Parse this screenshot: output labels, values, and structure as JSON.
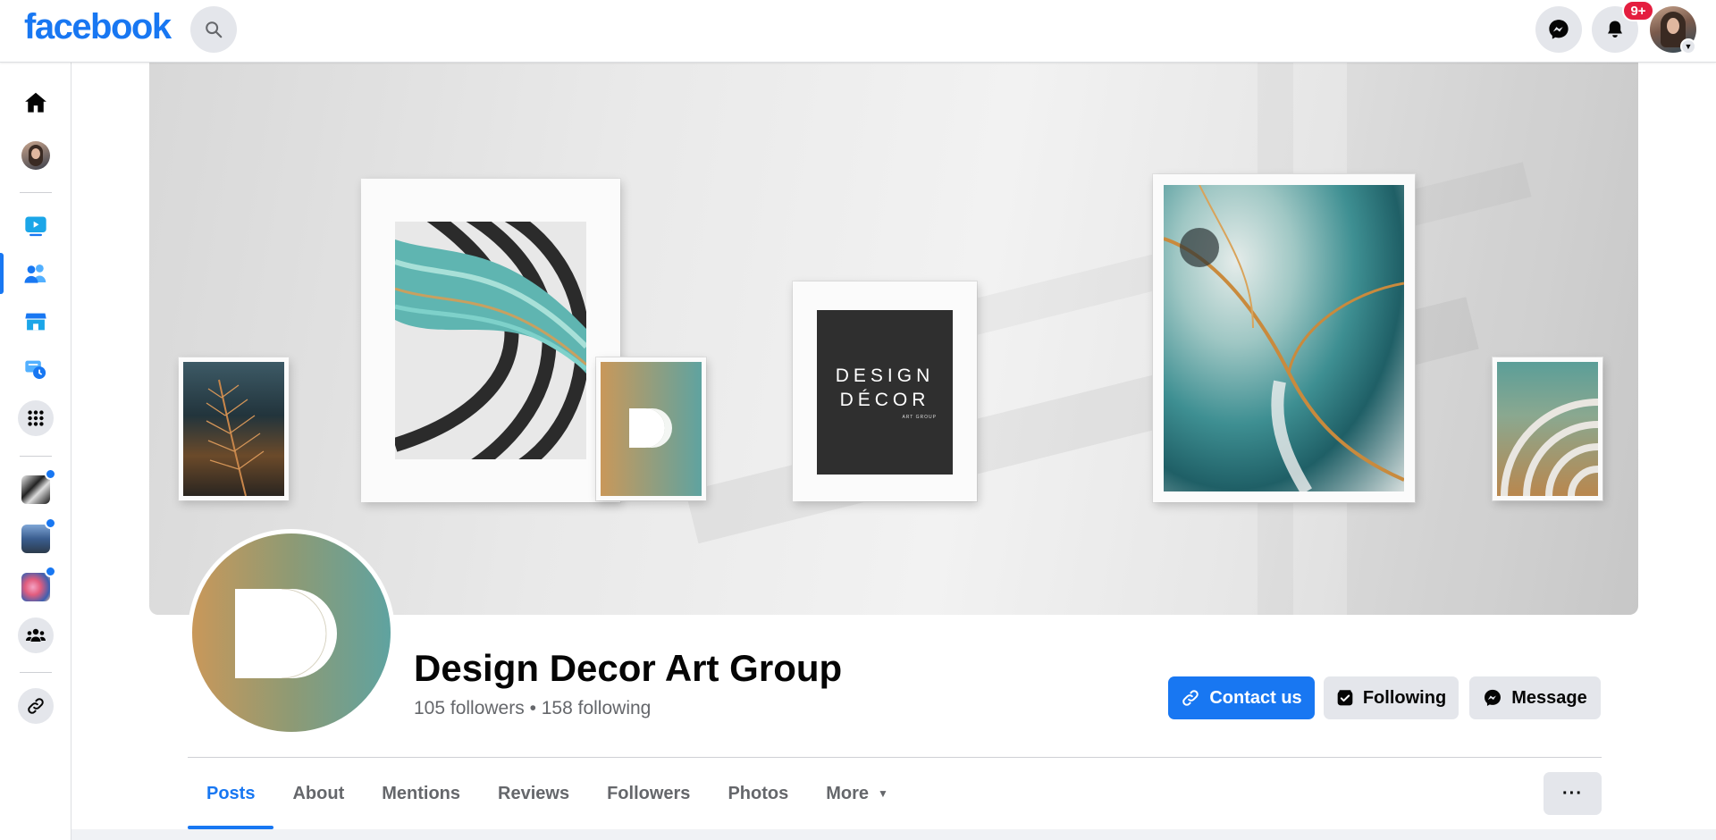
{
  "brand": {
    "logo_text": "facebook",
    "color": "#1877f2"
  },
  "topbar": {
    "notifications_badge": "9+"
  },
  "icons": {
    "search": "search-icon",
    "messenger": "messenger-icon",
    "bell": "bell-icon",
    "home": "home-icon",
    "watch": "video-icon",
    "friends": "friends-icon",
    "marketplace": "marketplace-icon",
    "memories": "memories-icon",
    "menu": "grid-menu-icon",
    "groups": "groups-icon",
    "link": "link-icon"
  },
  "page": {
    "name": "Design Decor Art Group",
    "stats": "105 followers • 158 following",
    "cover_logo_line1": "DESIGN",
    "cover_logo_line2": "DÉCOR",
    "cover_logo_line3": "ART GROUP"
  },
  "actions": {
    "contact": "Contact us",
    "following": "Following",
    "message": "Message",
    "more": "···"
  },
  "tabs": [
    {
      "label": "Posts",
      "active": true
    },
    {
      "label": "About"
    },
    {
      "label": "Mentions"
    },
    {
      "label": "Reviews"
    },
    {
      "label": "Followers"
    },
    {
      "label": "Photos"
    },
    {
      "label": "More"
    }
  ],
  "colors": {
    "primary": "#1877f2",
    "badge": "#e41e3f",
    "secondary_bg": "#e4e6eb",
    "muted_text": "#65676b"
  }
}
